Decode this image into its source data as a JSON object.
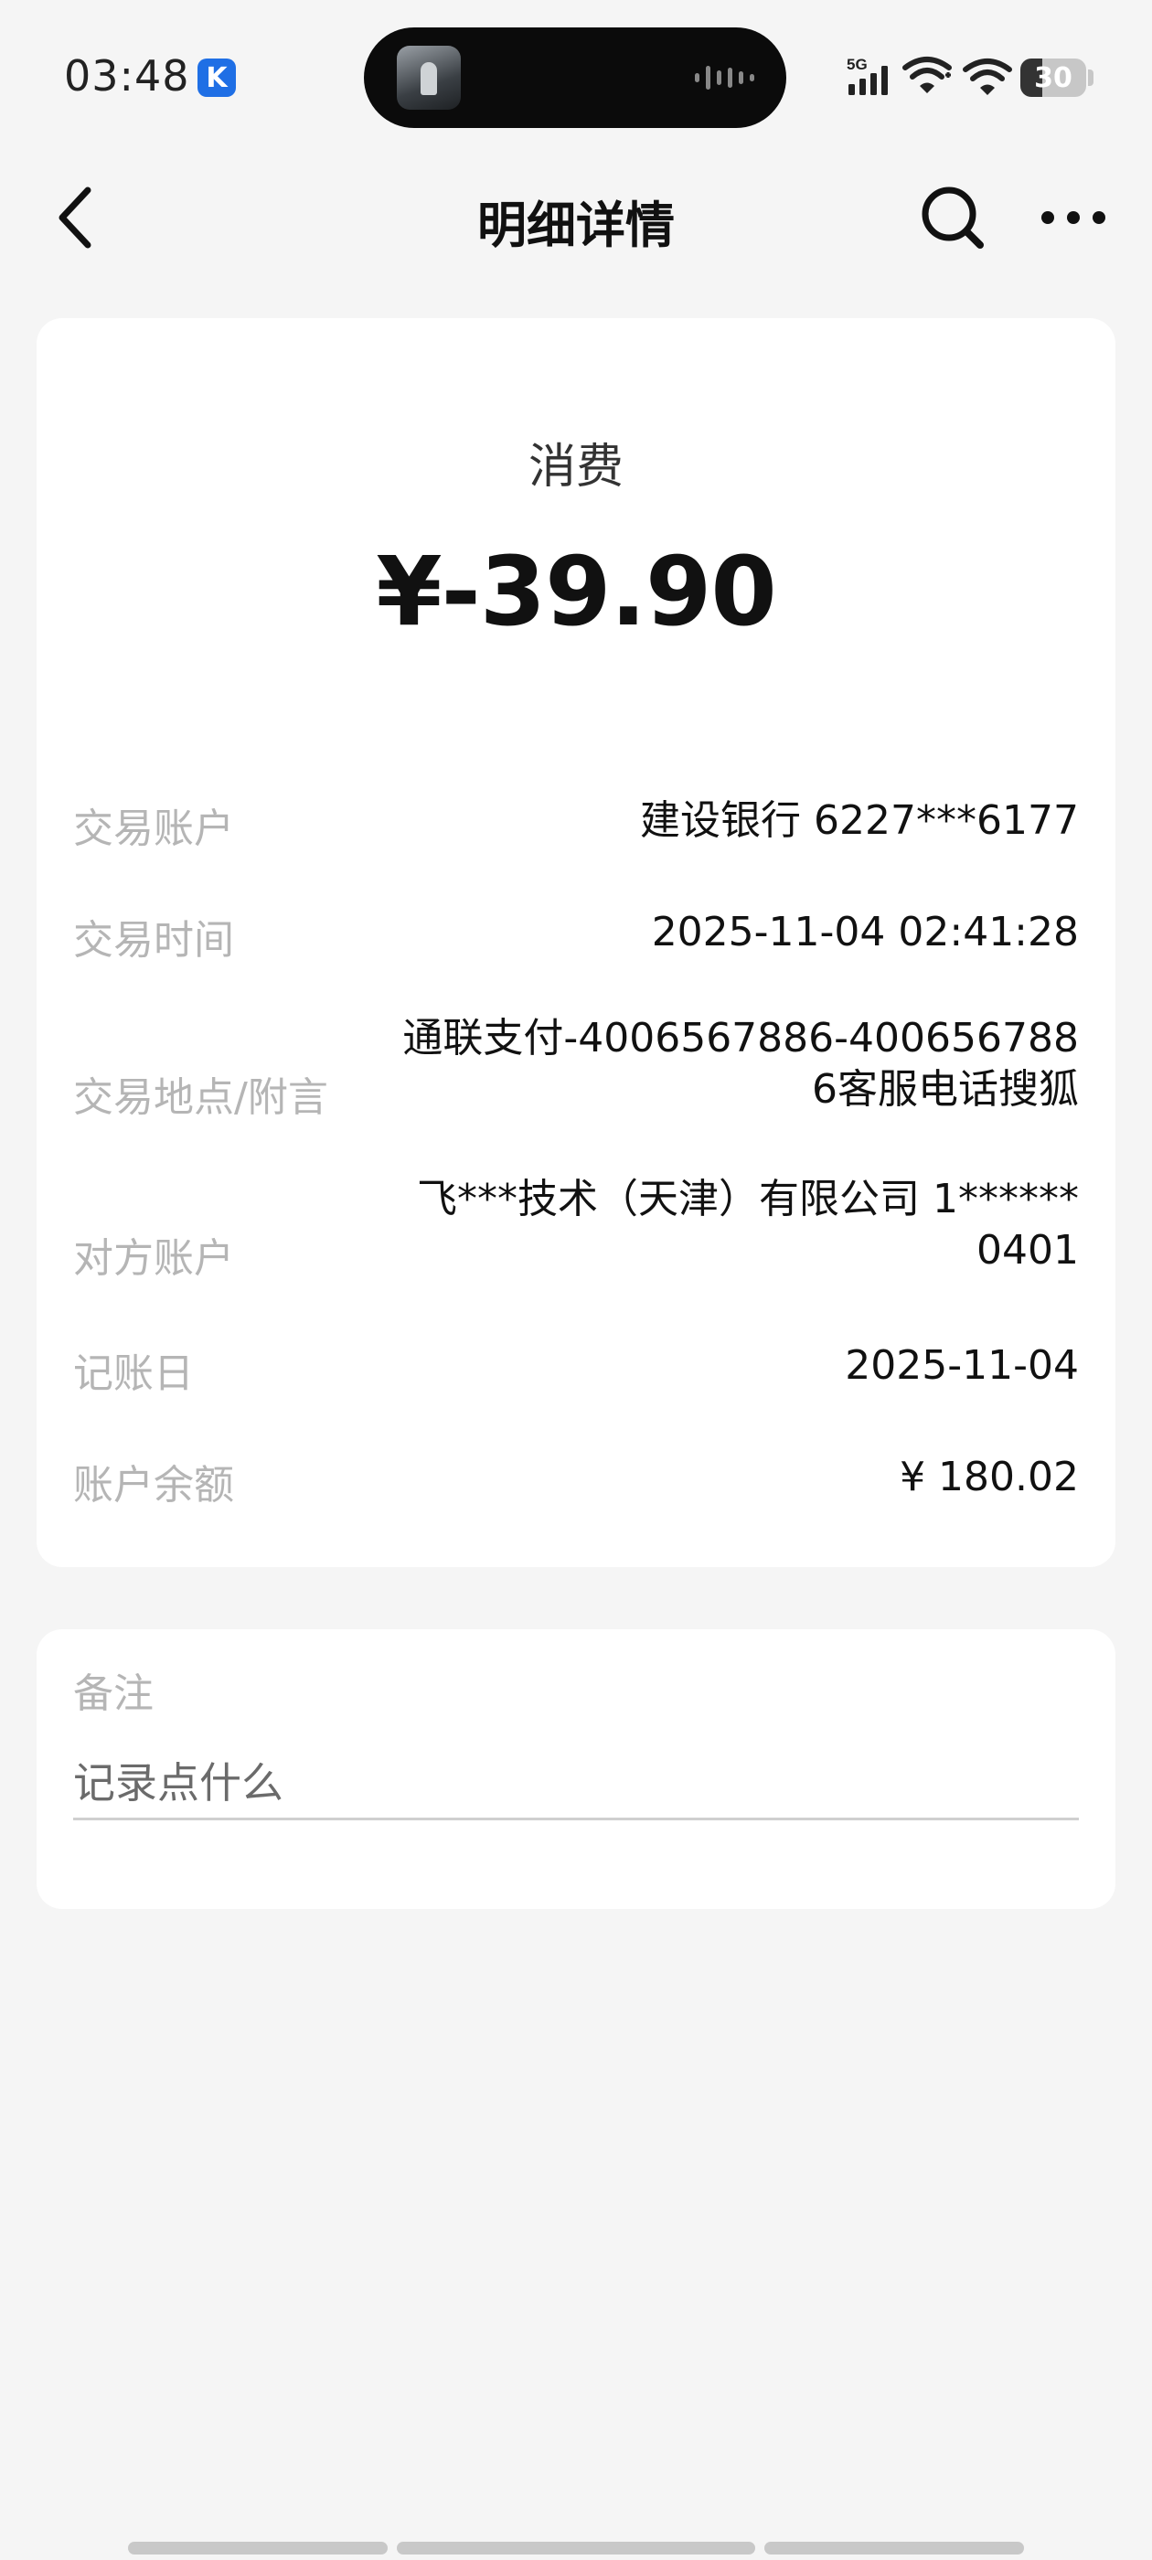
{
  "status_bar": {
    "time": "03:48",
    "app_badge": "K",
    "network": "5G",
    "battery": "30"
  },
  "nav": {
    "title": "明细详情"
  },
  "transaction": {
    "type": "消费",
    "amount": "¥-39.90",
    "rows": [
      {
        "label": "交易账户",
        "value": "建设银行 6227***6177"
      },
      {
        "label": "交易时间",
        "value": "2025-11-04 02:41:28"
      },
      {
        "label": "交易地点/附言",
        "value_line1": "通联支付-4006567886-400656788",
        "value_line2": "6客服电话搜狐"
      },
      {
        "label": "对方账户",
        "value_line1": "飞***技术（天津）有限公司 1******",
        "value_line2": "0401"
      },
      {
        "label": "记账日",
        "value": "2025-11-04"
      },
      {
        "label": "账户余额",
        "value": "¥ 180.02"
      }
    ]
  },
  "note": {
    "label": "备注",
    "placeholder": "记录点什么"
  }
}
